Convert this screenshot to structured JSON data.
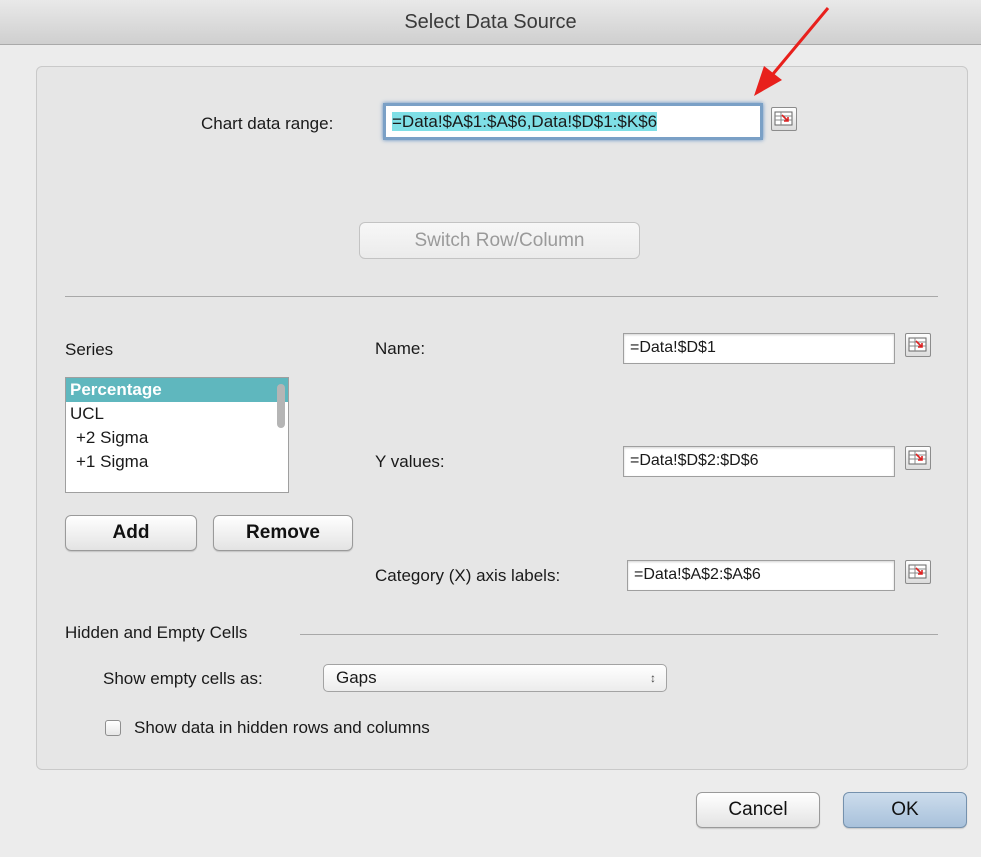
{
  "window": {
    "title": "Select Data Source"
  },
  "chart_range": {
    "label": "Chart data range:",
    "value": "=Data!$A$1:$A$6,Data!$D$1:$K$6"
  },
  "switch_button": {
    "label": "Switch Row/Column"
  },
  "series": {
    "heading": "Series",
    "items": [
      "Percentage",
      "UCL",
      "+2 Sigma",
      "+1 Sigma"
    ],
    "selected_index": 0,
    "add_label": "Add",
    "remove_label": "Remove"
  },
  "fields": {
    "name_label": "Name:",
    "name_value": "=Data!$D$1",
    "y_label": "Y values:",
    "y_value": "=Data!$D$2:$D$6",
    "x_label": "Category (X) axis labels:",
    "x_value": "=Data!$A$2:$A$6"
  },
  "hidden_empty": {
    "heading": "Hidden and Empty Cells",
    "show_empty_label": "Show empty cells as:",
    "show_empty_value": "Gaps",
    "hidden_data_label": "Show data in hidden rows and columns",
    "hidden_data_checked": false
  },
  "buttons": {
    "cancel": "Cancel",
    "ok": "OK"
  },
  "colors": {
    "annotation_arrow": "#e8201c",
    "selected_row": "#5fb7be",
    "highlight": "#7fdfe6"
  }
}
